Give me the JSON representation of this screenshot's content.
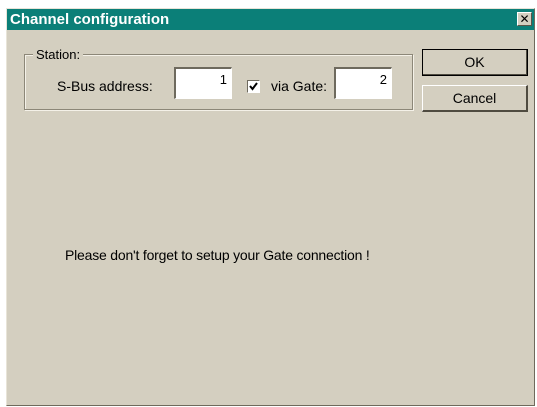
{
  "window": {
    "title": "Channel configuration",
    "close_glyph": "✕",
    "background_color": "#d4cfc0",
    "titlebar_color": "#0b7f78"
  },
  "station": {
    "group_label": "Station:",
    "sbus_label": "S-Bus address:",
    "sbus_value": "1",
    "via_gate_checked": true,
    "via_gate_label": "via Gate:",
    "gate_value": "2"
  },
  "buttons": {
    "ok_label": "OK",
    "cancel_label": "Cancel"
  },
  "message": "Please don't forget to setup your Gate connection !"
}
